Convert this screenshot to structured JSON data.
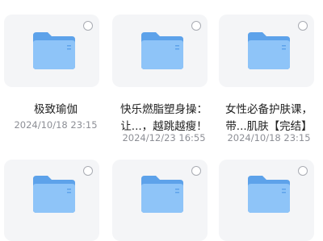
{
  "items": [
    {
      "title_line1": "极致瑜伽",
      "title_line2": "",
      "date": "2024/10/18 23:15",
      "icon": "folder-icon"
    },
    {
      "title_line1": "快乐燃脂塑身操：",
      "title_line2": "让...，越跳越瘦！",
      "date": "2024/12/23 16:55",
      "icon": "folder-icon"
    },
    {
      "title_line1": "女性必备护肤课，",
      "title_line2": "带...肌肤【完结】",
      "date": "2024/10/18 23:15",
      "icon": "folder-icon"
    },
    {
      "icon": "folder-icon"
    },
    {
      "icon": "folder-icon"
    },
    {
      "icon": "folder-icon"
    }
  ],
  "colors": {
    "folder_back": "#5da2ea",
    "folder_front": "#8ec4f8",
    "tile_bg": "#f4f5f7",
    "date_text": "#8d8f96"
  }
}
